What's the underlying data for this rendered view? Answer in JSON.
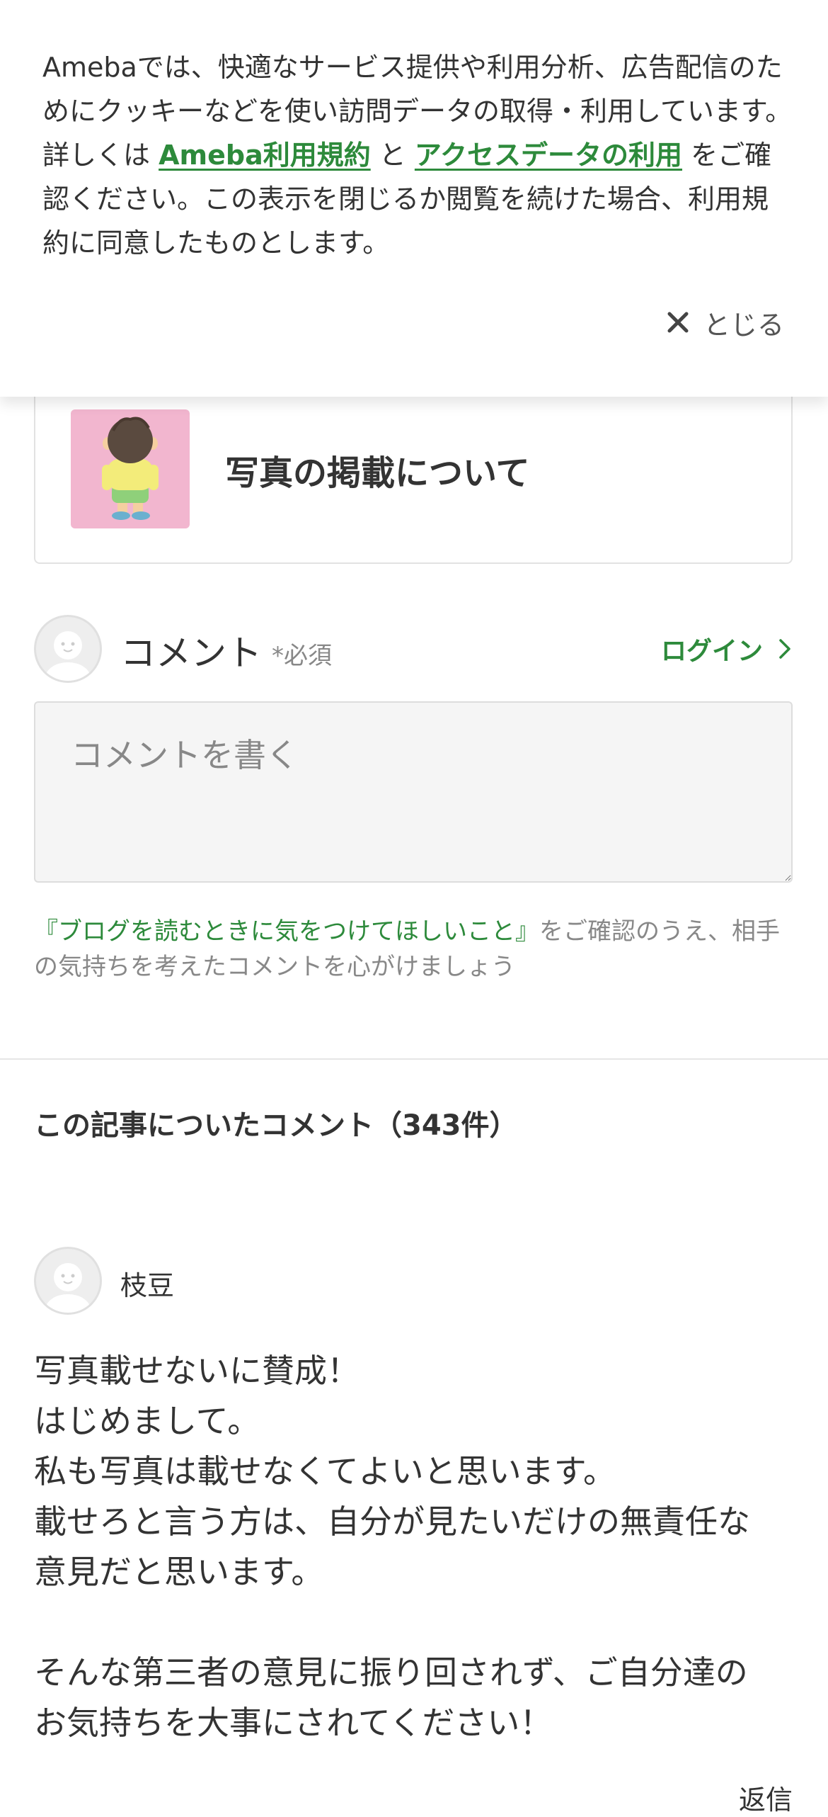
{
  "cookie_banner": {
    "text_before": "Amebaでは、快適なサービス提供や利用分析、広告配信のためにクッキーなどを使い訪問データの取得・利用しています。詳しくは ",
    "terms_link": "Ameba利用規約",
    "conjunction": " と ",
    "access_data_link": "アクセスデータの利用",
    "text_after": " をご確認ください。この表示を閉じるか閲覧を続けた場合、利用規約に同意したものとします。",
    "close_label": "とじる"
  },
  "entry_card": {
    "title": "写真の掲載について"
  },
  "comment_form": {
    "label": "コメント",
    "required": "*必須",
    "login": "ログイン",
    "placeholder": "コメントを書く",
    "guideline_link": "『ブログを読むときに気をつけてほしいこと』",
    "guideline_text": "をご確認のうえ、相手の気持ちを考えたコメントを心がけましょう"
  },
  "comments": {
    "title": "この記事についたコメント（343件）",
    "items": [
      {
        "author": "枝豆",
        "lines": [
          "写真載せないに賛成！",
          "はじめまして。",
          "私も写真は載せなくてよいと思います。",
          "載せろと言う方は、自分が見たいだけの無責任な",
          "意見だと思います。",
          "",
          "そんな第三者の意見に振り回されず、ご自分達の",
          "お気持ちを大事にされてください！"
        ],
        "reply": "返信"
      }
    ]
  },
  "colors": {
    "accent_green": "#2d8a3b",
    "text": "#333333",
    "muted": "#888888",
    "thumb_bg": "#f2b6cf"
  }
}
